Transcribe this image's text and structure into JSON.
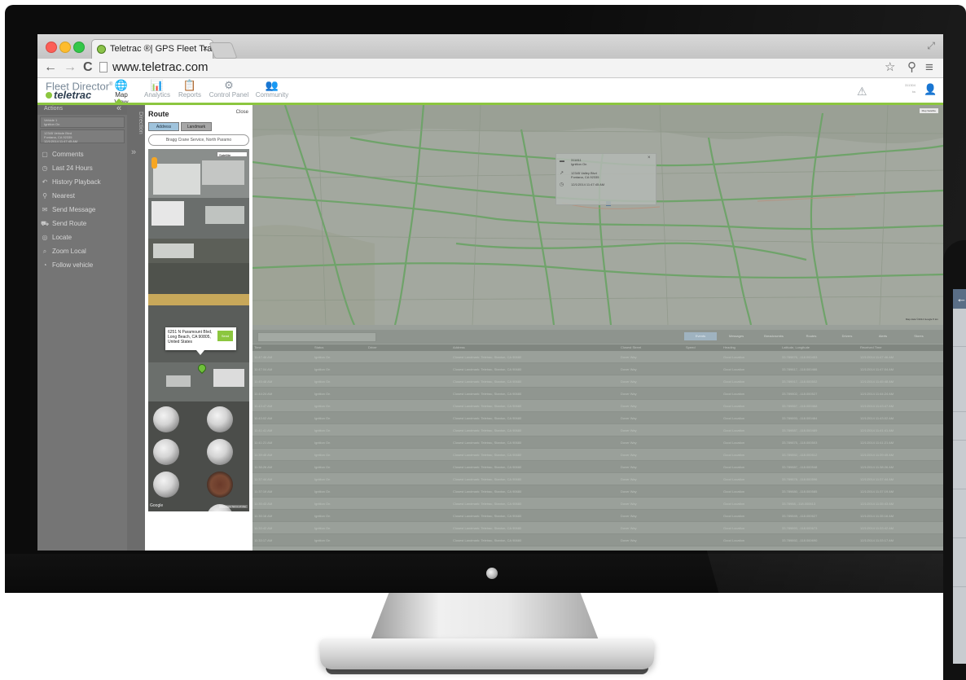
{
  "browser": {
    "tab_title": "Teletrac ®| GPS Fleet Track",
    "tab_close": "×",
    "url": "www.teletrac.com",
    "back": "←",
    "forward": "→",
    "reload": "C",
    "star": "☆",
    "location": "⚲",
    "menu": "≡",
    "fullscreen": "⤢"
  },
  "app": {
    "brand_line1": "Fleet Director",
    "brand_line1_mark": "®",
    "brand_line2": "teletrac",
    "accent_color": "#8cc63f",
    "nav": [
      {
        "label": "Map View",
        "icon": "🌐",
        "active": true
      },
      {
        "label": "Analytics",
        "icon": "📊",
        "active": false
      },
      {
        "label": "Reports",
        "icon": "📋",
        "active": false
      },
      {
        "label": "Control Panel",
        "icon": "⚙",
        "active": false
      },
      {
        "label": "Community",
        "icon": "👥",
        "active": false
      }
    ],
    "alert_icon": "⚠",
    "account_line1": "311304",
    "account_line2": "tw",
    "user_icon": "👤"
  },
  "sidebar": {
    "header": "Actions",
    "collapse": "«",
    "vehicle_box": [
      "Vehicle 1",
      "Ignition On"
    ],
    "vehicle_box2": [
      "12345 Vehicle Blvd",
      "Fontana, CA 92335",
      "12/1/2014 11:47:45 AM"
    ],
    "items": [
      {
        "label": "Comments",
        "icon": "▢"
      },
      {
        "label": "Last 24 Hours",
        "icon": "◷"
      },
      {
        "label": "History Playback",
        "icon": "↶"
      },
      {
        "label": "Nearest",
        "icon": "⚲"
      },
      {
        "label": "Send Message",
        "icon": "✉"
      },
      {
        "label": "Send Route",
        "icon": "⛟"
      },
      {
        "label": "Locate",
        "icon": "◎"
      },
      {
        "label": "Zoom Local",
        "icon": "⌕"
      },
      {
        "label": "Follow vehicle",
        "icon": "◔"
      }
    ],
    "directions_label": "Direction",
    "directions_chev": "»"
  },
  "route": {
    "title": "Route",
    "close": "Close",
    "tab_address": "Address",
    "tab_landmark": "Landmark",
    "search_value": "Bragg Crane Service, North Paramo",
    "map_type": "Satellite",
    "popup_address": "6251 N Paramount Blvd, Long Beach, CA 90805, United States",
    "popup_button": "Send",
    "footer_logo": "Google",
    "footer_terms": "Map Data  Terms of Use"
  },
  "map": {
    "controls": "Map  Satellite",
    "footer": "Map data ©2014 Google  5 km",
    "info": {
      "line1": "311811",
      "line2": "Ignition On",
      "line3": "12345 Valley Blvd",
      "line4": "Fontana, CA 92335",
      "line5": "12/1/2014 11:47:45 AM"
    }
  },
  "grid": {
    "buttons": [
      "Events",
      "Messages",
      "Breadcrumbs",
      "Routes",
      "Drivers",
      "Alerts",
      "Stores"
    ],
    "headers": [
      "Time",
      "Status",
      "Driver",
      "Address",
      "Closest Street",
      "Speed",
      "Heading",
      "Latitude, Longitude",
      "Received Time"
    ],
    "rows": [
      [
        "11:47:46 AM",
        "Ignition On",
        "",
        "Closest Landmark: Teletrac, Stanton, CA 90680",
        "Dover Way",
        "",
        "Good Location",
        "33.789876, -118.000453",
        "12/1/2014 11:47:46 AM"
      ],
      [
        "11:47:04 AM",
        "Ignition On",
        "",
        "Closest Landmark: Teletrac, Stanton, CA 90680",
        "Dover Way",
        "",
        "Good Location",
        "33.789817, -118.000466",
        "12/1/2014 11:47:04 AM"
      ],
      [
        "11:45:48 AM",
        "Ignition On",
        "",
        "Closest Landmark: Teletrac, Stanton, CA 90680",
        "Dover Way",
        "",
        "Good Location",
        "33.789917, -118.000502",
        "12/1/2014 11:45:48 AM"
      ],
      [
        "11:44:24 AM",
        "Ignition On",
        "",
        "Closest Landmark: Teletrac, Stanton, CA 90680",
        "Dover Way",
        "",
        "Good Location",
        "33.789802, -118.000527",
        "12/1/2014 11:44:24 AM"
      ],
      [
        "11:43:47 AM",
        "Ignition On",
        "",
        "Closest Landmark: Teletrac, Stanton, CA 90680",
        "Dover Way",
        "",
        "Good Location",
        "33.789867, -118.000468",
        "12/1/2014 11:43:47 AM"
      ],
      [
        "11:43:02 AM",
        "Ignition On",
        "",
        "Closest Landmark: Teletrac, Stanton, CA 90680",
        "Dover Way",
        "",
        "Good Location",
        "33.789893, -118.000464",
        "12/1/2014 11:43:02 AM"
      ],
      [
        "11:41:41 AM",
        "Ignition On",
        "",
        "Closest Landmark: Teletrac, Stanton, CA 90680",
        "Dover Way",
        "",
        "Good Location",
        "33.789887, -118.000489",
        "12/1/2014 11:41:41 AM"
      ],
      [
        "11:41:21 AM",
        "Ignition On",
        "",
        "Closest Landmark: Teletrac, Stanton, CA 90680",
        "Dover Way",
        "",
        "Good Location",
        "33.789875, -118.000503",
        "12/1/2014 11:41:21 AM"
      ],
      [
        "11:39:45 AM",
        "Ignition On",
        "",
        "Closest Landmark: Teletrac, Stanton, CA 90680",
        "Dover Way",
        "",
        "Good Location",
        "33.789892, -118.000512",
        "12/1/2014 11:39:45 AM"
      ],
      [
        "11:38:26 AM",
        "Ignition On",
        "",
        "Closest Landmark: Teletrac, Stanton, CA 90680",
        "Dover Way",
        "",
        "Good Location",
        "33.789887, -118.000548",
        "12/1/2014 11:38:26 AM"
      ],
      [
        "11:37:44 AM",
        "Ignition On",
        "",
        "Closest Landmark: Teletrac, Stanton, CA 90680",
        "Dover Way",
        "",
        "Good Location",
        "33.789878, -118.000596",
        "12/1/2014 11:37:44 AM"
      ],
      [
        "11:37:19 AM",
        "Ignition On",
        "",
        "Closest Landmark: Teletrac, Stanton, CA 90680",
        "Dover Way",
        "",
        "Good Location",
        "33.789880, -118.000585",
        "12/1/2014 11:37:19 AM"
      ],
      [
        "11:35:43 AM",
        "Ignition On",
        "",
        "Closest Landmark: Teletrac, Stanton, CA 90680",
        "Dover Way",
        "",
        "Good Location",
        "33.78988, -118.000613",
        "12/1/2014 11:35:43 AM"
      ],
      [
        "11:35:16 AM",
        "Ignition On",
        "",
        "Closest Landmark: Teletrac, Stanton, CA 90680",
        "Dover Way",
        "",
        "Good Location",
        "33.789849, -118.000627",
        "12/1/2014 11:35:16 AM"
      ],
      [
        "11:33:42 AM",
        "Ignition On",
        "",
        "Closest Landmark: Teletrac, Stanton, CA 90680",
        "Dover Way",
        "",
        "Good Location",
        "33.789893, -118.000673",
        "12/1/2014 11:33:42 AM"
      ],
      [
        "11:33:17 AM",
        "Ignition On",
        "",
        "Closest Landmark: Teletrac, Stanton, CA 90680",
        "Dover Way",
        "",
        "Good Location",
        "33.789892, -118.000690",
        "12/1/2014 11:33:17 AM"
      ],
      [
        "11:31:47 AM",
        "Ignition On",
        "",
        "Closest Landmark: Teletrac, Stanton, CA 90680",
        "Dover Way",
        "",
        "Good Location",
        "33.789893, -118.000705",
        "12/1/2014 11:31:47 AM"
      ]
    ]
  },
  "tablet": {
    "back_icon": "←"
  }
}
